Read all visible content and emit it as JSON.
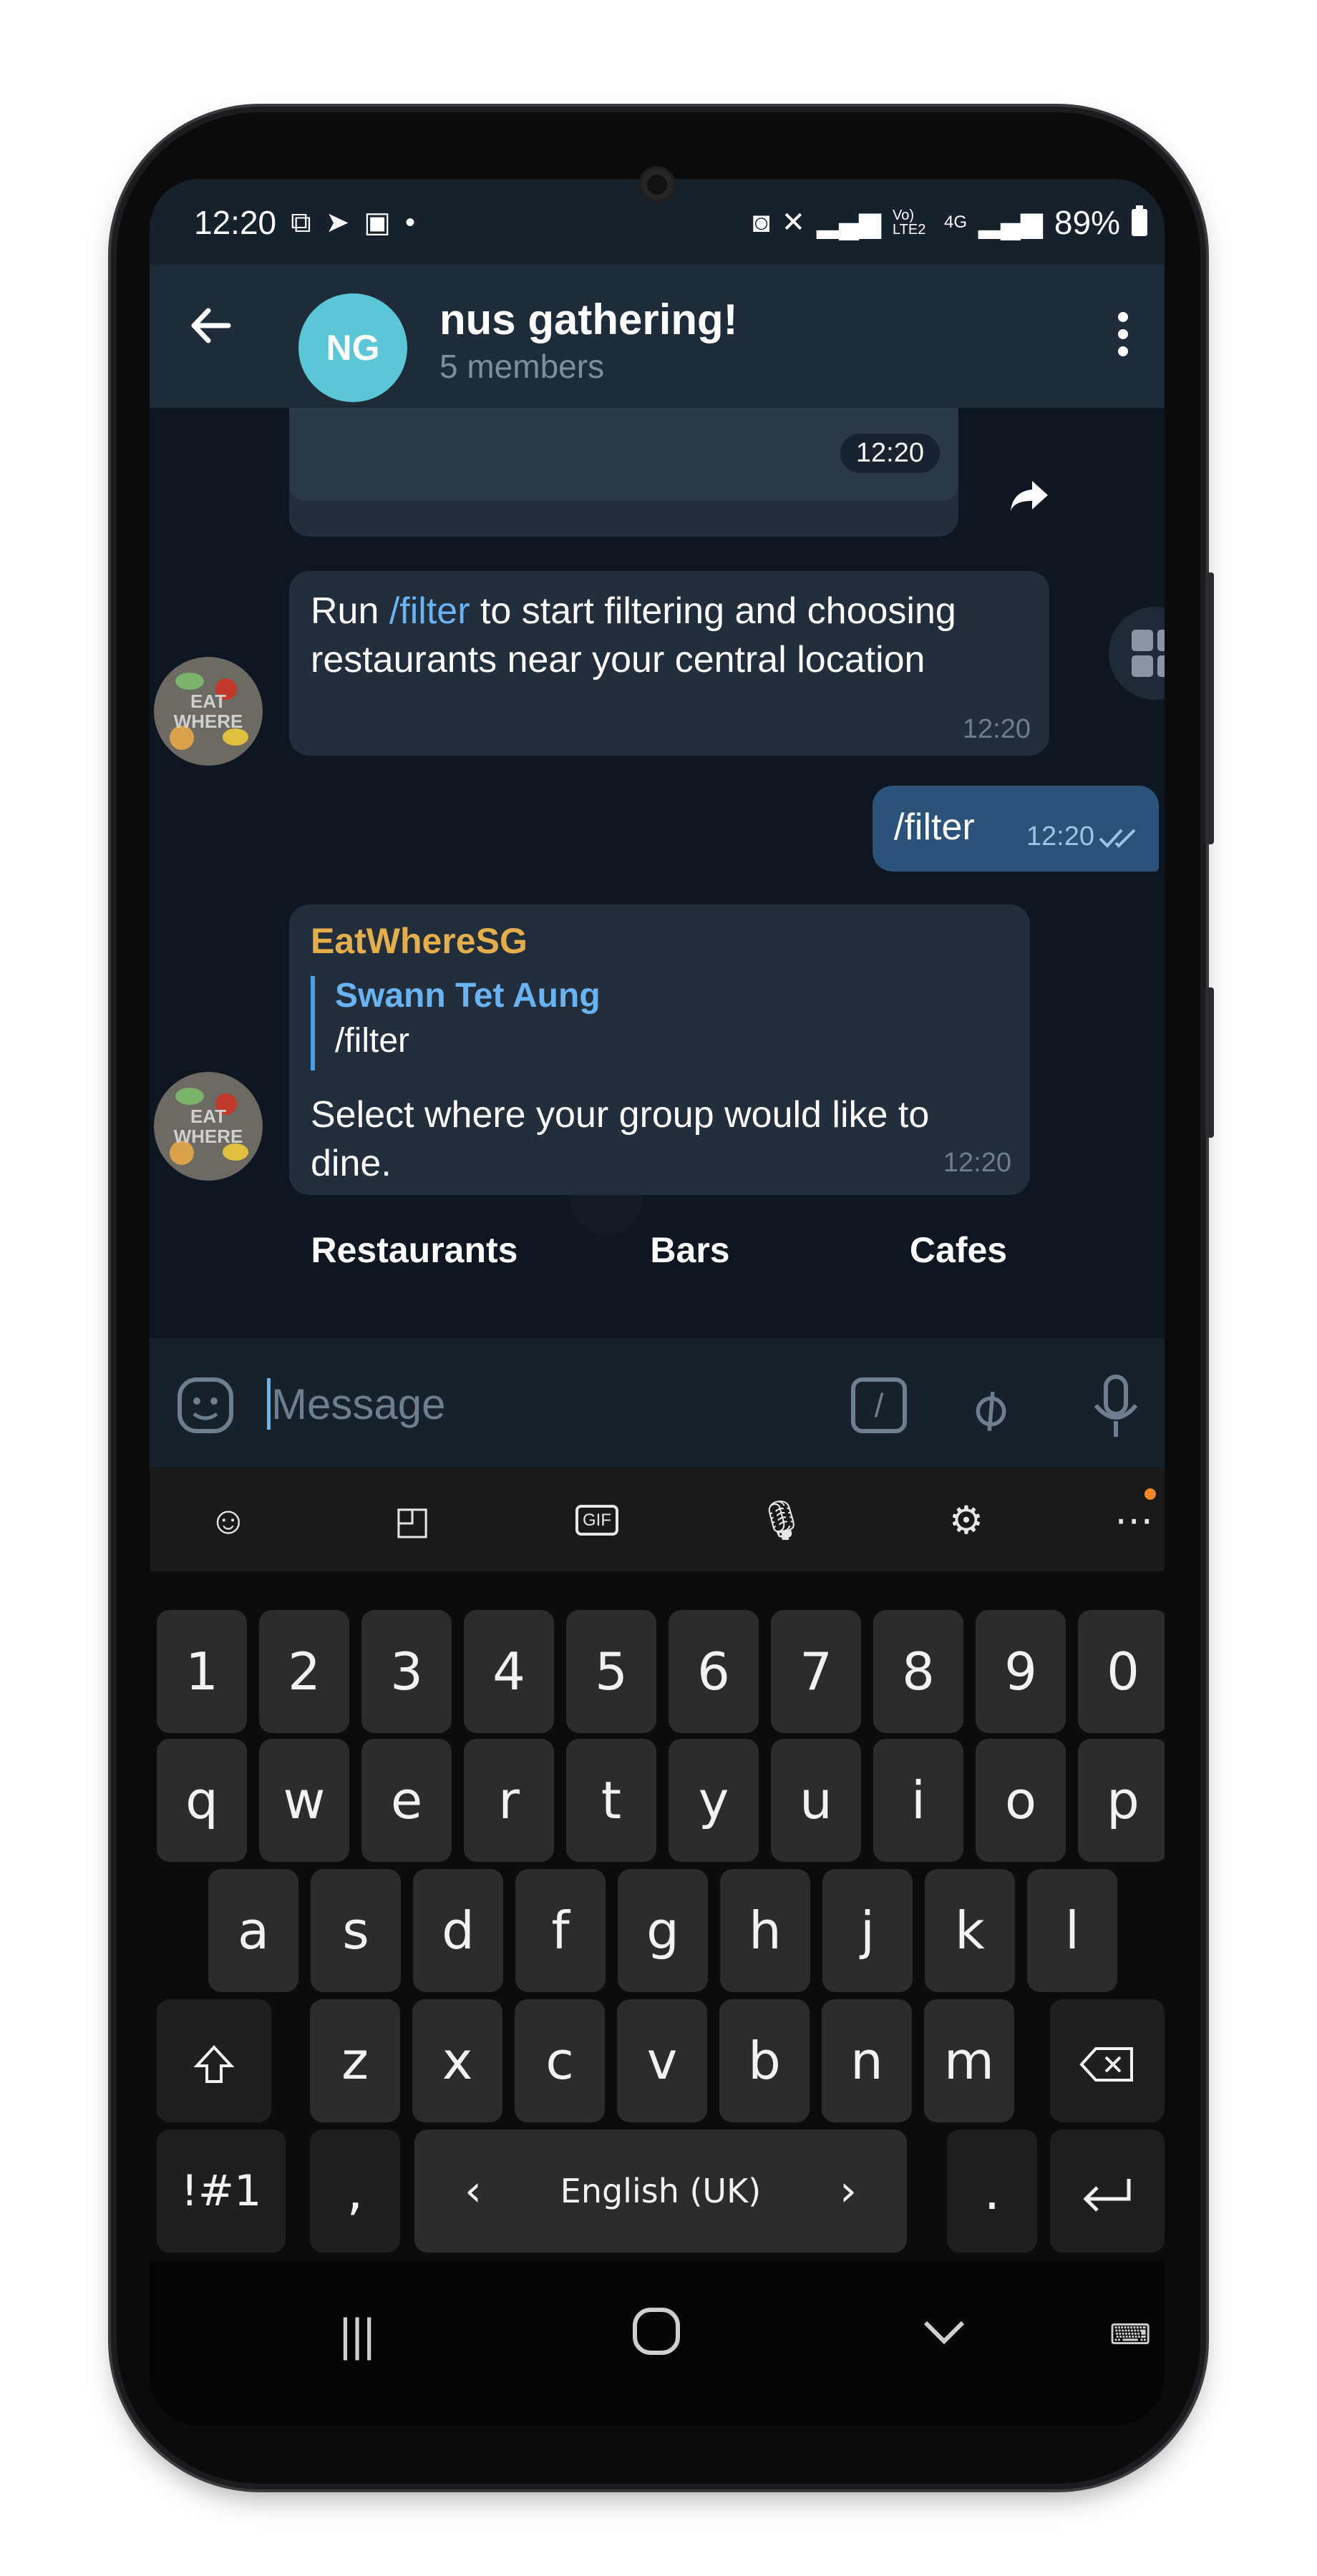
{
  "status_bar": {
    "time": "12:20",
    "network": "Vo) LTE2",
    "signal_type": "4G",
    "battery": "89%"
  },
  "header": {
    "avatar_initials": "NG",
    "title": "nus gathering!",
    "subtitle": "5 members"
  },
  "messages": [
    {
      "id": "prev",
      "time": "12:20"
    },
    {
      "id": "bot1",
      "parts": [
        "Run ",
        "/filter",
        " to start filtering and choosing restaurants near your central location"
      ],
      "time": "12:20"
    },
    {
      "id": "out1",
      "text": "/filter",
      "time": "12:20"
    },
    {
      "id": "bot2",
      "sender": "EatWhereSG",
      "reply_name": "Swann Tet Aung",
      "reply_text": "/filter",
      "text": "Select where your group would like to dine.",
      "time": "12:20"
    }
  ],
  "inline_keyboard": [
    "Restaurants",
    "Bars",
    "Cafes"
  ],
  "bot_avatar_text": "EAT WHERE",
  "input": {
    "placeholder": "Message",
    "command_icon": "/"
  },
  "keyboard": {
    "row_numbers": [
      "1",
      "2",
      "3",
      "4",
      "5",
      "6",
      "7",
      "8",
      "9",
      "0"
    ],
    "row1": [
      "q",
      "w",
      "e",
      "r",
      "t",
      "y",
      "u",
      "i",
      "o",
      "p"
    ],
    "row2": [
      "a",
      "s",
      "d",
      "f",
      "g",
      "h",
      "j",
      "k",
      "l"
    ],
    "row3": [
      "z",
      "x",
      "c",
      "v",
      "b",
      "n",
      "m"
    ],
    "symbols_key": "!#1",
    "comma_key": ",",
    "space_label": "English (UK)",
    "space_left": "‹",
    "space_right": "›",
    "period_key": "."
  },
  "icons": [
    "back-arrow-icon",
    "more-vert-icon",
    "forward-icon",
    "apps-grid-icon",
    "sticker-icon",
    "bot-command-icon",
    "attach-icon",
    "mic-icon",
    "emoji-icon",
    "gif-icon",
    "settings-icon",
    "more-icon",
    "shift-icon",
    "backspace-icon",
    "enter-icon",
    "recent-apps-icon",
    "home-icon",
    "back-nav-icon",
    "keyboard-icon"
  ],
  "colors": {
    "header_bg": "#1e2c3a",
    "chat_bg": "#0e1621",
    "bubble_in": "#222e3b",
    "bubble_out": "#2b5278",
    "link": "#6ab3f3",
    "sender": "#e4ae4b",
    "avatar_ng": "#5bc6d5"
  }
}
